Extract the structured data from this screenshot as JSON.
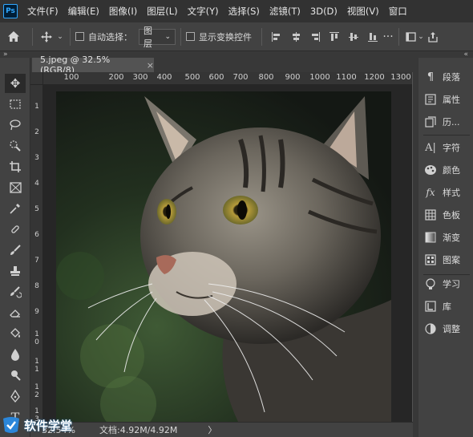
{
  "app": {
    "logo": "Ps"
  },
  "menu": [
    "文件(F)",
    "编辑(E)",
    "图像(I)",
    "图层(L)",
    "文字(Y)",
    "选择(S)",
    "滤镜(T)",
    "3D(D)",
    "视图(V)",
    "窗口"
  ],
  "options": {
    "auto_select_label": "自动选择：",
    "auto_select_target": "图层",
    "show_transform_label": "显示变换控件"
  },
  "document": {
    "tab_title": "5.jpeg @ 32.5%(RGB/8)",
    "close_glyph": "×",
    "zoom": "32.54%",
    "info": "文档:4.92M/4.92M",
    "info_arrow": "〉"
  },
  "rulers": {
    "top": [
      "100",
      "200",
      "300",
      "400",
      "500",
      "600",
      "700",
      "800",
      "900",
      "1000",
      "1100",
      "1200",
      "1300"
    ],
    "left": [
      "1",
      "2",
      "3",
      "4",
      "5",
      "6",
      "7",
      "8",
      "9",
      "10",
      "11",
      "12",
      "13"
    ]
  },
  "tools": [
    "move-tool-icon",
    "marquee-tool-icon",
    "lasso-tool-icon",
    "quick-select-tool-icon",
    "crop-tool-icon",
    "frame-tool-icon",
    "eyedropper-tool-icon",
    "healing-brush-tool-icon",
    "brush-tool-icon",
    "clone-stamp-tool-icon",
    "history-brush-tool-icon",
    "eraser-tool-icon",
    "paint-bucket-tool-icon",
    "blur-tool-icon",
    "dodge-tool-icon",
    "pen-tool-icon",
    "type-tool-icon"
  ],
  "panels": [
    {
      "label": "段落",
      "icon": "paragraph-icon"
    },
    {
      "label": "属性",
      "icon": "properties-icon"
    },
    {
      "label": "历...",
      "icon": "history-icon"
    },
    {
      "label": "字符",
      "icon": "character-icon"
    },
    {
      "label": "颜色",
      "icon": "color-icon"
    },
    {
      "label": "样式",
      "icon": "styles-icon"
    },
    {
      "label": "色板",
      "icon": "swatches-icon"
    },
    {
      "label": "渐变",
      "icon": "gradient-icon"
    },
    {
      "label": "图案",
      "icon": "patterns-icon"
    },
    {
      "label": "学习",
      "icon": "learn-icon"
    },
    {
      "label": "库",
      "icon": "libraries-icon"
    },
    {
      "label": "调整",
      "icon": "adjustments-icon"
    }
  ],
  "watermark": {
    "text": "软件学堂"
  },
  "colors": {
    "ps_blue": "#31a8ff",
    "ps_dark": "#001e36",
    "ui_dark": "#323232",
    "ui_panel": "#424242",
    "ui_canvas": "#535353"
  }
}
